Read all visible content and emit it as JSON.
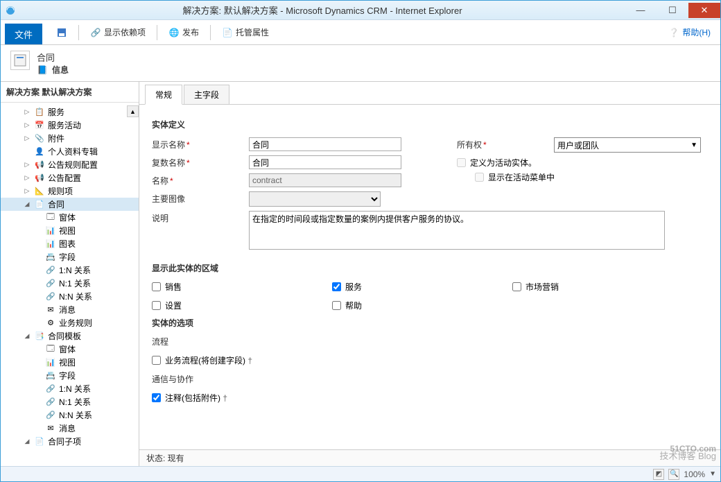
{
  "window": {
    "title": "解决方案: 默认解决方案 - Microsoft Dynamics CRM - Internet Explorer"
  },
  "ribbon": {
    "file": "文件",
    "show_deps": "显示依赖项",
    "publish": "发布",
    "managed_props": "托管属性",
    "help": "帮助(H)"
  },
  "header": {
    "entity": "合同",
    "subtitle": "信息"
  },
  "sidebar": {
    "title": "解决方案 默认解决方案",
    "items": [
      {
        "label": "服务",
        "exp": "▷",
        "ind": 1
      },
      {
        "label": "服务活动",
        "exp": "▷",
        "ind": 1
      },
      {
        "label": "附件",
        "exp": "▷",
        "ind": 1
      },
      {
        "label": "个人资料专辑",
        "ind": 1
      },
      {
        "label": "公告规则配置",
        "exp": "▷",
        "ind": 1
      },
      {
        "label": "公告配置",
        "exp": "▷",
        "ind": 1
      },
      {
        "label": "规则项",
        "exp": "▷",
        "ind": 1
      },
      {
        "label": "合同",
        "exp": "◢",
        "ind": 1,
        "sel": true
      },
      {
        "label": "窗体",
        "ind": 2
      },
      {
        "label": "视图",
        "ind": 2
      },
      {
        "label": "图表",
        "ind": 2
      },
      {
        "label": "字段",
        "ind": 2
      },
      {
        "label": "1:N 关系",
        "ind": 2
      },
      {
        "label": "N:1 关系",
        "ind": 2
      },
      {
        "label": "N:N 关系",
        "ind": 2
      },
      {
        "label": "消息",
        "ind": 2
      },
      {
        "label": "业务规则",
        "ind": 2
      },
      {
        "label": "合同模板",
        "exp": "◢",
        "ind": 1
      },
      {
        "label": "窗体",
        "ind": 2
      },
      {
        "label": "视图",
        "ind": 2
      },
      {
        "label": "字段",
        "ind": 2
      },
      {
        "label": "1:N 关系",
        "ind": 2
      },
      {
        "label": "N:1 关系",
        "ind": 2
      },
      {
        "label": "N:N 关系",
        "ind": 2
      },
      {
        "label": "消息",
        "ind": 2
      },
      {
        "label": "合同子项",
        "exp": "◢",
        "ind": 1
      }
    ]
  },
  "tabs": {
    "general": "常规",
    "primary": "主字段"
  },
  "form": {
    "sec_def": "实体定义",
    "display_name_lbl": "显示名称",
    "display_name": "合同",
    "plural_lbl": "复数名称",
    "plural": "合同",
    "name_lbl": "名称",
    "name": "contract",
    "image_lbl": "主要图像",
    "desc_lbl": "说明",
    "desc": "在指定的时间段或指定数量的案例内提供客户服务的协议。",
    "ownership_lbl": "所有权",
    "ownership": "用户或团队",
    "def_activity": "定义为活动实体。",
    "show_activity_menu": "显示在活动菜单中",
    "sec_areas": "显示此实体的区域",
    "a_sales": "销售",
    "a_service": "服务",
    "a_marketing": "市场营销",
    "a_settings": "设置",
    "a_help": "帮助",
    "sec_options": "实体的选项",
    "sec_process": "流程",
    "bp": "业务流程(将创建字段)",
    "sec_comm": "通信与协作",
    "notes": "注释(包括附件)"
  },
  "status": {
    "label": "状态: 现有"
  },
  "ie": {
    "zoom": "100%"
  },
  "watermark": {
    "main": "51CTO.com",
    "sub": "技术博客 Blog"
  }
}
